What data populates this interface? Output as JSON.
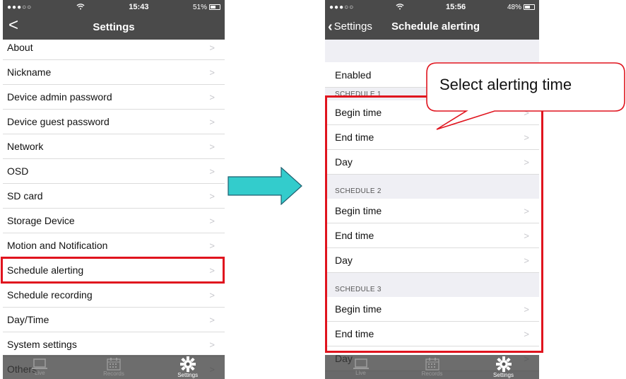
{
  "left": {
    "status": {
      "signal": "●●●○○",
      "wifi": "wifi-icon",
      "time": "15:43",
      "battery": "51%",
      "battery_level": 0.51
    },
    "nav": {
      "back": "<",
      "title": "Settings"
    },
    "items": [
      {
        "label": "About"
      },
      {
        "label": "Nickname"
      },
      {
        "label": "Device admin password"
      },
      {
        "label": "Device guest password"
      },
      {
        "label": "Network"
      },
      {
        "label": "OSD"
      },
      {
        "label": "SD card"
      },
      {
        "label": "Storage Device"
      },
      {
        "label": "Motion and Notification"
      },
      {
        "label": "Schedule alerting"
      },
      {
        "label": "Schedule recording"
      },
      {
        "label": "Day/Time"
      },
      {
        "label": "System settings"
      },
      {
        "label": "Others"
      }
    ],
    "tabs": [
      {
        "label": "Live",
        "icon": "laptop-icon"
      },
      {
        "label": "Records",
        "icon": "calendar-icon"
      },
      {
        "label": "Settings",
        "icon": "gear-icon"
      }
    ]
  },
  "right": {
    "status": {
      "signal": "●●●○○",
      "wifi": "wifi-icon",
      "time": "15:56",
      "battery": "48%",
      "battery_level": 0.48
    },
    "nav": {
      "back": "Settings",
      "title": "Schedule alerting"
    },
    "enabled_label": "Enabled",
    "sections": [
      {
        "header": "SCHEDULE 1",
        "rows": [
          "Begin time",
          "End time",
          "Day"
        ]
      },
      {
        "header": "SCHEDULE 2",
        "rows": [
          "Begin time",
          "End time",
          "Day"
        ]
      },
      {
        "header": "SCHEDULE 3",
        "rows": [
          "Begin time"
        ]
      }
    ],
    "partial_rows": [
      "End time",
      "Day"
    ],
    "tabs": [
      {
        "label": "Live",
        "icon": "laptop-icon"
      },
      {
        "label": "Records",
        "icon": "calendar-icon"
      },
      {
        "label": "Settings",
        "icon": "gear-icon"
      }
    ]
  },
  "callout": {
    "text": "Select alerting time"
  },
  "chevron": ">",
  "colors": {
    "highlight": "#e0141e",
    "arrow": "#33cccc",
    "navbar": "#4a4a4a"
  }
}
